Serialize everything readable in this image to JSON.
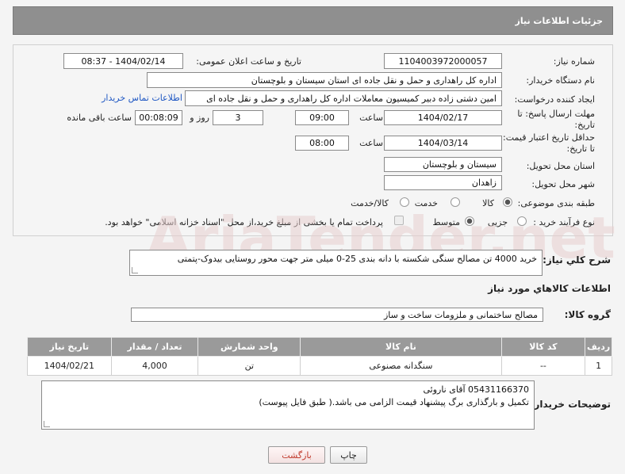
{
  "header": {
    "title": "جزئیات اطلاعات نیاز"
  },
  "form": {
    "need_number": {
      "label": "شماره نیاز:",
      "value": "1104003972000057"
    },
    "announce_datetime": {
      "label": "تاریخ و ساعت اعلان عمومی:",
      "value": "1404/02/14 - 08:37"
    },
    "buyer_org": {
      "label": "نام دستگاه خریدار:",
      "value": "اداره کل راهداری و حمل و نقل جاده ای استان سیستان و بلوچستان"
    },
    "requester": {
      "label": "ایجاد کننده درخواست:",
      "value": "امین دشتی زاده دبیر کمیسیون معاملات اداره کل راهداری و حمل و نقل جاده ای",
      "contact_link": "اطلاعات تماس خریدار"
    },
    "reply_deadline": {
      "label_line1": "مهلت ارسال پاسخ: تا",
      "label_line2": "تاریخ:",
      "date": "1404/02/17",
      "time_label": "ساعت",
      "time": "09:00",
      "days": "3",
      "days_label": "روز و",
      "remaining": "00:08:09",
      "remaining_label": "ساعت باقی مانده"
    },
    "price_validity": {
      "label_line1": "حداقل تاریخ اعتبار قیمت:",
      "label_line2": "تا تاریخ:",
      "date": "1404/03/14",
      "time_label": "ساعت",
      "time": "08:00"
    },
    "delivery_province": {
      "label": "استان محل تحویل:",
      "value": "سیستان و بلوچستان"
    },
    "delivery_city": {
      "label": "شهر محل تحویل:",
      "value": "زاهدان"
    },
    "category": {
      "label": "طبقه بندی موضوعی:",
      "options": [
        "کالا",
        "خدمت",
        "کالا/خدمت"
      ],
      "selected": "کالا"
    },
    "purchase_process": {
      "label": "نوع فرآیند خرید :",
      "options": [
        "جزیی",
        "متوسط"
      ],
      "selected": "متوسط",
      "note": "پرداخت تمام یا بخشی از مبلغ خرید،از محل \"اسناد خزانه اسلامی\" خواهد بود."
    }
  },
  "description": {
    "label": "شرح کلي نياز:",
    "value": "خرید 4000 تن مصالح سنگی شکسته با دانه بندی 25-0 میلی متر جهت محور روستایی بیدوک-پتمتی"
  },
  "goods_info": {
    "title": "اطلاعات کالاهاي مورد نياز"
  },
  "goods_group": {
    "label": "گروه کالا:",
    "value": "مصالح ساختمانی و ملزومات ساخت و ساز"
  },
  "table": {
    "headers": [
      "ردیف",
      "کد کالا",
      "نام کالا",
      "واحد شمارش",
      "تعداد / مقدار",
      "تاریخ نیاز"
    ],
    "rows": [
      [
        "1",
        "--",
        "سنگدانه مصنوعی",
        "تن",
        "4,000",
        "1404/02/21"
      ]
    ]
  },
  "buyer_notes": {
    "label": "توضیحات خریدار:",
    "line1": "05431166370 آقای ناروئی",
    "line2": "تکمیل و بارگذاری برگ پیشنهاد قیمت الزامی می باشد.( طبق فایل پیوست)"
  },
  "buttons": {
    "print": "چاپ",
    "back": "بازگشت"
  },
  "watermark": {
    "text": "AriaTender.net"
  },
  "colors": {
    "header_bg": "#8f8f8f",
    "link": "#1f57c3",
    "back_text": "#c0392b",
    "watermark": "#d9b3b3"
  }
}
